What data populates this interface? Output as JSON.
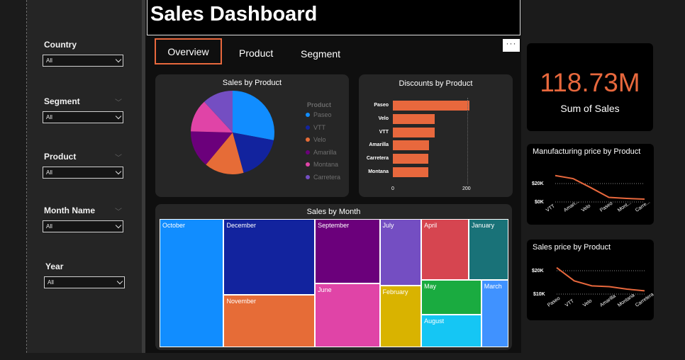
{
  "title": "Sales Dashboard",
  "tabs": [
    {
      "label": "Overview",
      "active": true
    },
    {
      "label": "Product",
      "active": false
    },
    {
      "label": "Segment",
      "active": false
    }
  ],
  "more_button": "···",
  "filters": [
    {
      "label": "Country",
      "value": "All"
    },
    {
      "label": "Segment",
      "value": "All"
    },
    {
      "label": "Product",
      "value": "All"
    },
    {
      "label": "Month Name",
      "value": "All"
    },
    {
      "label": "Year",
      "value": "All"
    }
  ],
  "kpi": {
    "value": "118.73M",
    "label": "Sum of  Sales"
  },
  "colors": {
    "accent": "#e8683d",
    "background": "#1b1b1b",
    "card": "#262626"
  },
  "chart_data": [
    {
      "id": "sales-by-product",
      "type": "pie",
      "title": "Sales by Product",
      "legend_title": "Product",
      "legend": "right",
      "categories": [
        "Paseo",
        "VTT",
        "Velo",
        "Amarilla",
        "Montana",
        "Carretera"
      ],
      "values": [
        33,
        21,
        18,
        17,
        15,
        14
      ],
      "colors": [
        "#118dff",
        "#12239e",
        "#e66c37",
        "#6b007b",
        "#e044a7",
        "#744ec2"
      ]
    },
    {
      "id": "discounts-by-product",
      "type": "bar",
      "orientation": "horizontal",
      "title": "Discounts by Product",
      "categories": [
        "Paseo",
        "Velo",
        "VTT",
        "Amarilla",
        "Carretera",
        "Montana"
      ],
      "values": [
        205,
        113,
        113,
        97,
        95,
        95
      ],
      "xlim": [
        0,
        200
      ],
      "xticks": [
        "0",
        "200"
      ],
      "color": "#e8683d"
    },
    {
      "id": "sales-by-month",
      "type": "treemap",
      "title": "Sales by Month",
      "categories": [
        "October",
        "December",
        "November",
        "September",
        "June",
        "July",
        "February",
        "April",
        "January",
        "May",
        "August",
        "March"
      ],
      "values": [
        19,
        16,
        11,
        9.7,
        9.5,
        6.4,
        5.9,
        6.7,
        5.6,
        4.8,
        4.5,
        4.2
      ],
      "colors": [
        "#118dff",
        "#12239e",
        "#e66c37",
        "#6b007b",
        "#e044a7",
        "#744ec2",
        "#d9b300",
        "#d64550",
        "#197278",
        "#1aab40",
        "#15c6f4",
        "#4092ff"
      ]
    },
    {
      "id": "manufacturing-price-by-product",
      "type": "line",
      "title": "Manufacturing price by Product",
      "categories": [
        "VTT",
        "Amarilla",
        "Velo",
        "Paseo",
        "Montana",
        "Carretera"
      ],
      "category_labels": [
        "VTT",
        "Amari...",
        "Velo",
        "Paseo",
        "Mont...",
        "Carre..."
      ],
      "values": [
        26000,
        23000,
        14000,
        4500,
        3500,
        2800
      ],
      "yticks": [
        "$20K",
        "$0K"
      ],
      "ylim": [
        0,
        30000
      ],
      "color": "#e8683d"
    },
    {
      "id": "sales-price-by-product",
      "type": "line",
      "title": "Sales price by Product",
      "categories": [
        "Paseo",
        "VTT",
        "Velo",
        "Amarilla",
        "Montana",
        "Carretera"
      ],
      "values": [
        24000,
        16000,
        13000,
        12500,
        11000,
        10000
      ],
      "yticks": [
        "$20K",
        "$10K"
      ],
      "ylim": [
        8000,
        26000
      ],
      "color": "#e8683d"
    }
  ]
}
